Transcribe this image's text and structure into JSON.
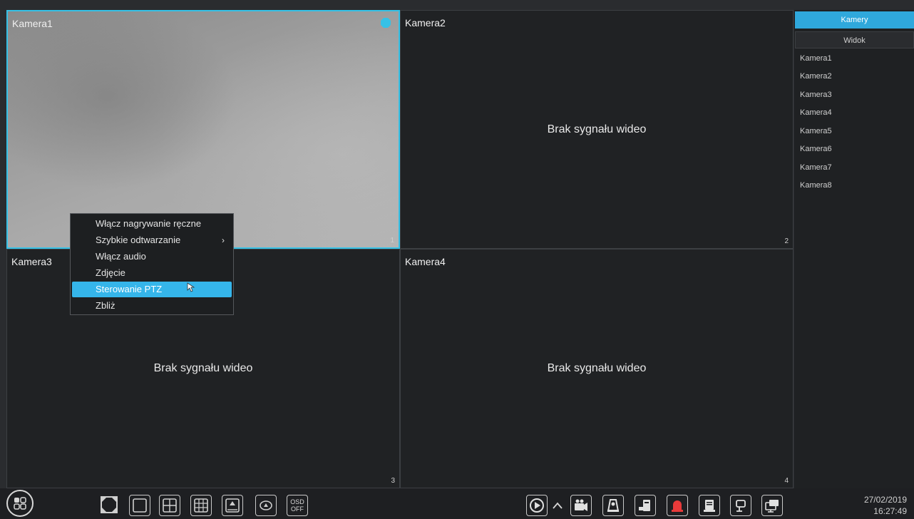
{
  "cameras": [
    {
      "title": "Kamera1",
      "index": "1",
      "signal": ""
    },
    {
      "title": "Kamera2",
      "index": "2",
      "signal": "Brak sygnału wideo"
    },
    {
      "title": "Kamera3",
      "index": "3",
      "signal": "Brak sygnału wideo"
    },
    {
      "title": "Kamera4",
      "index": "4",
      "signal": "Brak sygnału wideo"
    }
  ],
  "context_menu": {
    "items": [
      {
        "label": "Włącz nagrywanie ręczne"
      },
      {
        "label": "Szybkie odtwarzanie",
        "arrow": "›"
      },
      {
        "label": "Włącz audio"
      },
      {
        "label": "Zdjęcie"
      },
      {
        "label": "Sterowanie PTZ",
        "highlighted": true
      },
      {
        "label": "Zbliż"
      }
    ]
  },
  "sidebar": {
    "tabs": [
      {
        "label": "Kamery",
        "active": true
      },
      {
        "label": "Widok",
        "active": false
      }
    ],
    "camera_list": [
      "Kamera1",
      "Kamera2",
      "Kamera3",
      "Kamera4",
      "Kamera5",
      "Kamera6",
      "Kamera7",
      "Kamera8"
    ]
  },
  "toolbar": {
    "osd_label_top": "OSD",
    "osd_label_bottom": "OFF",
    "icons": [
      "menu-icon",
      "fullscreen-icon",
      "layout-1-icon",
      "layout-4-icon",
      "layout-9-icon",
      "layout-custom-icon",
      "rotate-view-icon",
      "osd-off-icon",
      "playback-icon",
      "expand-up-icon",
      "manual-record-icon",
      "snapshot-icon",
      "broadcast-icon",
      "alarm-icon",
      "storage-icon",
      "ptz-icon",
      "screen-switch-icon"
    ]
  },
  "datetime": {
    "date": "27/02/2019",
    "time": "16:27:49"
  },
  "colors": {
    "accent": "#35c1e6",
    "highlight": "#35b5ea",
    "alarm": "#e83a3a"
  }
}
